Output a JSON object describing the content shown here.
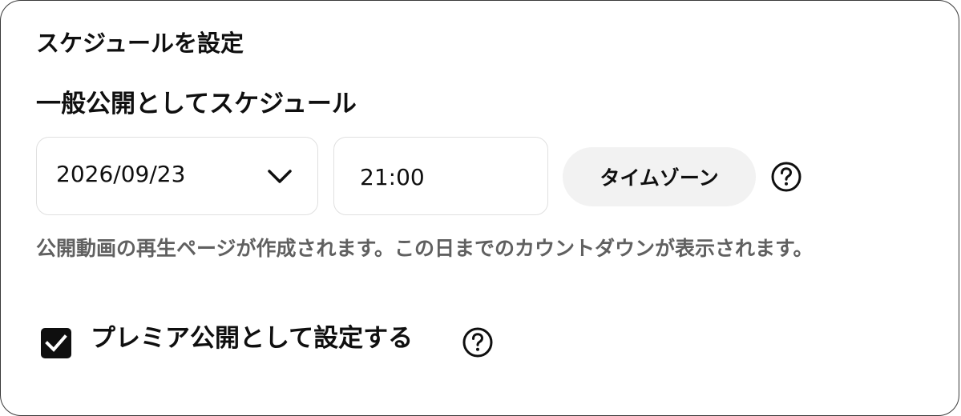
{
  "dialog": {
    "title": "スケジュールを設定"
  },
  "schedule": {
    "heading": "一般公開としてスケジュール",
    "date_value": "2026/09/23",
    "time_value": "21:00",
    "timezone_label": "タイムゾーン",
    "description": "公開動画の再生ページが作成されます。この日までのカウントダウンが表示されます。"
  },
  "premiere": {
    "checked": true,
    "label": "プレミア公開として設定する"
  },
  "icons": {
    "dropdown": "chevron-down-icon",
    "help": "help-circle-icon",
    "check": "check-icon"
  },
  "colors": {
    "text": "#0f0f0f",
    "secondary_text": "#606060",
    "field_border": "#e0e0e0",
    "button_bg": "#f2f2f2",
    "checkbox_bg": "#0f0f0f"
  }
}
